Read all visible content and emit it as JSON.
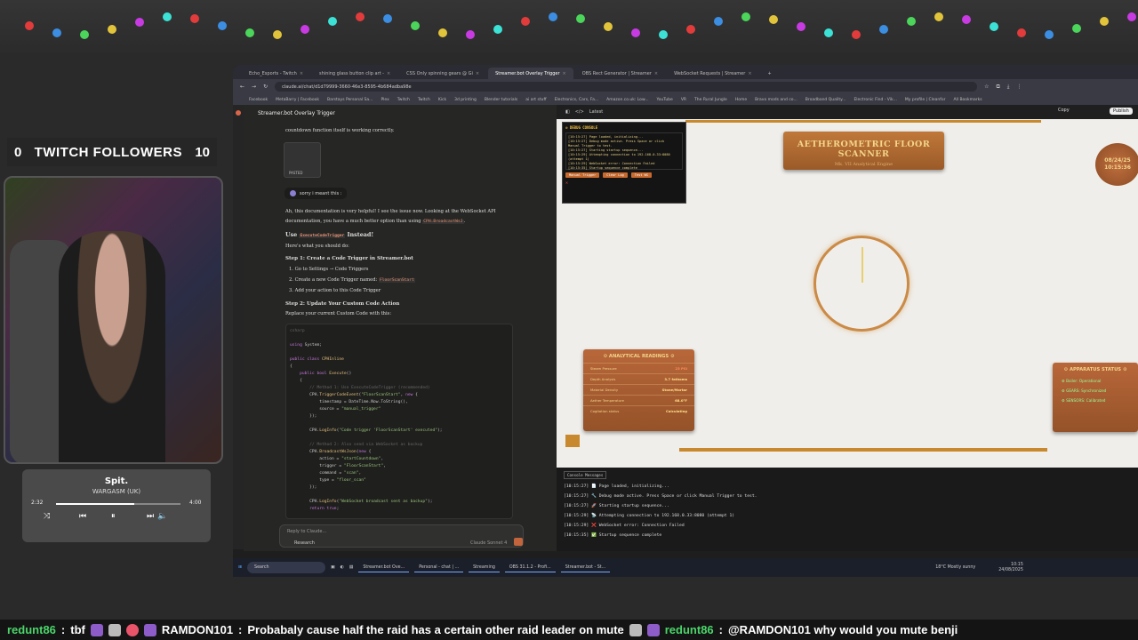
{
  "overlay": {
    "followers": {
      "count": "0",
      "label": "TWITCH FOLLOWERS",
      "goal": "10"
    },
    "music": {
      "title": "Spit.",
      "artist": "WARGASM (UK)",
      "elapsed": "2:32",
      "total": "4:00",
      "progress": 0.63
    }
  },
  "browser": {
    "tabs": [
      {
        "label": "Echo_Esports - Twitch"
      },
      {
        "label": "shining glass button clip art -"
      },
      {
        "label": "CSS Only spinning gears @ Gi"
      },
      {
        "label": "Streamer.bot Overlay Trigger"
      },
      {
        "label": "OBS Rect Generator | Streamer"
      },
      {
        "label": "WebSocket Requests | Streamer"
      }
    ],
    "url": "claude.ai/chat/d1d79999-3660-46e3-8595-4b684adba98e",
    "bookmarks": [
      "Facebook",
      "MetaBarry | Facebook",
      "Barstays Personal Sa...",
      "Plex",
      "Twitch",
      "Twitch",
      "Kick",
      "3d printing",
      "Blender tutorials",
      "ai art stuff",
      "Electronics, Cars, Fa...",
      "Amazon.co.uk: Low...",
      "YouTube",
      "VR",
      "The Rural Jungle",
      "Home",
      "Bravo mods and co...",
      "Broadband Quality...",
      "Electronic Find - Vik...",
      "My profile | Cleanfor",
      "All Bookmarks"
    ]
  },
  "chat": {
    "title": "Streamer.bot Overlay Trigger",
    "intro": "countdown function itself is working correctly.",
    "attachment": "PASTED",
    "user_msg": "sorry i meant this :",
    "p1": "Ah, this documentation is very helpful! I see the issue now. Looking at the WebSocket API",
    "p2a": "documentation, you have a much better option than using",
    "p2code": "CPH.BroadcastWsJ",
    "h1a": "Use",
    "h1code": "ExecuteCodeTrigger",
    "h1b": "Instead!",
    "p3": "Here's what you should do:",
    "step1": "Step 1: Create a Code Trigger in Streamer.bot",
    "li1": "1. Go to Settings → Code Triggers",
    "li2a": "2. Create a new Code Trigger named:",
    "li2code": "FloorScanStart",
    "li3": "3. Add your action to this Code Trigger",
    "step2": "Step 2: Update Your Custom Code Action",
    "p4": "Replace your current Custom Code with this:",
    "reply_placeholder": "Reply to Claude...",
    "research": "Research",
    "model": "Claude Sonnet 4"
  },
  "artifact": {
    "version": "Latest",
    "copy": "Copy",
    "publish": "Publish",
    "debug": {
      "title": "⚙ DEBUG CONSOLE",
      "logs": [
        "[10:15:27] Page loaded, initializing...",
        "[10:15:27] Debug mode active. Press Space or click",
        "Manual Trigger to test.",
        "[10:15:27] Starting startup sequence...",
        "[10:15:29] Attempting connection to 192.168.0.33:8080",
        "(attempt 1)",
        "[10:15:29] WebSocket error: Connection Failed",
        "[10:15:35] Startup sequence complete"
      ],
      "btn_manual": "Manual Trigger",
      "btn_clear": "Clear Log",
      "btn_test": "Test WS"
    },
    "scanner": {
      "title": "AETHEROMETRIC FLOOR SCANNER",
      "subtitle": "Mk. VII Analytical Engine"
    },
    "date": {
      "date": "08/24/25",
      "time": "10:15:36"
    },
    "readings": {
      "title": "⚙ ANALYTICAL READINGS ⚙",
      "rows": [
        {
          "k": "Steam Pressure",
          "v": "23 PSI"
        },
        {
          "k": "Depth Analysis",
          "v": "3.7 fathoms"
        },
        {
          "k": "Material Density",
          "v": "Stone/Mortar"
        },
        {
          "k": "Aether Temperature",
          "v": "68.0°F"
        },
        {
          "k": "Cogitation status",
          "v": "Calculating"
        }
      ]
    },
    "status": {
      "title": "⚙ APPARATUS STATUS ⚙",
      "items": [
        "⚙ Boiler: Operational",
        "⚙ GEARS: Synchronized",
        "⚙ SENSORS: Calibrated"
      ]
    },
    "console": {
      "button": "Console Messages",
      "lines": [
        "[10:15:27] 📄 Page loaded, initializing...",
        "[10:15:27] 🔧 Debug mode active. Press Space or click Manual Trigger to test.",
        "[10:15:27] 🚀 Starting startup sequence...",
        "[10:15:29] 📡 Attempting connection to 192.168.0.33:8080 (attempt 1)",
        "[10:15:29] ❌ WebSocket error: Connection Failed",
        "[10:15:35] ✅ Startup sequence complete"
      ]
    }
  },
  "taskbar": {
    "search": "Search",
    "apps": [
      "Streamer.bot Ove...",
      "Personal - chat | ...",
      "Streaming",
      "OBS 31.1.2 - Profi...",
      "Streamer.bot - St..."
    ],
    "weather": "18°C",
    "weather2": "Mostly sunny",
    "time": "10:15",
    "date": "24/08/2025"
  },
  "ticker": {
    "n1": "redunt86",
    "m1": "tbf",
    "n2": "RAMDON101",
    "m2": "Probabaly cause half the raid has a certain other raid leader on mute",
    "n3": "redunt86",
    "m3": "@RAMDON101 why would you mute benji"
  }
}
